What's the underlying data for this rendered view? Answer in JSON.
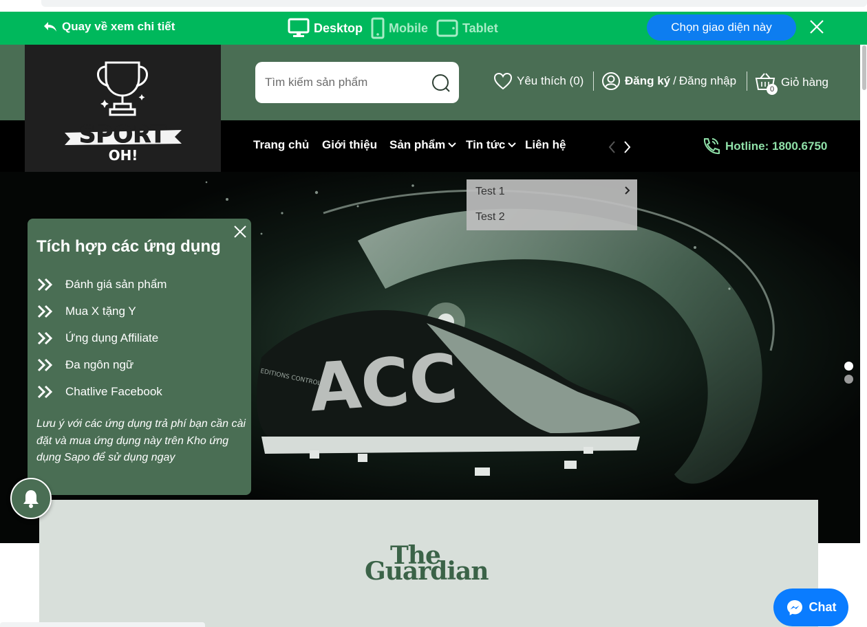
{
  "preview_bar": {
    "back_label": "Quay về xem chi tiết",
    "devices": [
      {
        "label": "Desktop",
        "icon": "desktop-icon",
        "active": true
      },
      {
        "label": "Mobile",
        "icon": "mobile-icon",
        "active": false
      },
      {
        "label": "Tablet",
        "icon": "tablet-icon",
        "active": false
      }
    ],
    "choose_label": "Chọn giao diện này"
  },
  "logo": {
    "line1": "SPORT",
    "line2": "OH!"
  },
  "search": {
    "placeholder": "Tìm kiếm sản phẩm"
  },
  "header": {
    "wishlist_label": "Yêu thích (0)",
    "register_label": "Đăng ký",
    "separator": "/",
    "login_label": "Đăng nhập",
    "cart_label": "Giỏ hàng",
    "cart_count": "0"
  },
  "nav": {
    "items": [
      {
        "label": "Trang chủ",
        "has_dropdown": false
      },
      {
        "label": "Giới thiệu",
        "has_dropdown": false
      },
      {
        "label": "Sản phẩm",
        "has_dropdown": true
      },
      {
        "label": "Tin tức",
        "has_dropdown": true
      },
      {
        "label": "Liên hệ",
        "has_dropdown": false
      }
    ],
    "hotline": "Hotline: 1800.6750"
  },
  "dropdown": {
    "items": [
      {
        "label": "Test 1",
        "has_submenu": true
      },
      {
        "label": "Test 2",
        "has_submenu": false
      }
    ]
  },
  "hero": {
    "shoe_text": "ACC",
    "shoe_small_text": "EDITIONS CONTROL"
  },
  "slider": {
    "slide_count": 2,
    "active_index": 0
  },
  "apps_panel": {
    "title": "Tích hợp các ứng dụng",
    "items": [
      "Đánh giá sản phẩm",
      "Mua X tặng Y",
      "Ứng dụng Affiliate",
      "Đa ngôn ngữ",
      "Chatlive Facebook"
    ],
    "note": "Lưu ý với các ứng dụng trả phí bạn cần cài đặt và mua ứng dụng này trên Kho ứng dụng Sapo để sử dụng ngay"
  },
  "brand_logo": {
    "line1": "The",
    "line2": "Guardian"
  },
  "chat": {
    "label": "Chat"
  },
  "colors": {
    "preview_green": "#00b85c",
    "header_green": "#4a6e54",
    "button_blue": "#0d7df0",
    "hotline_green": "#8fe0a8"
  }
}
